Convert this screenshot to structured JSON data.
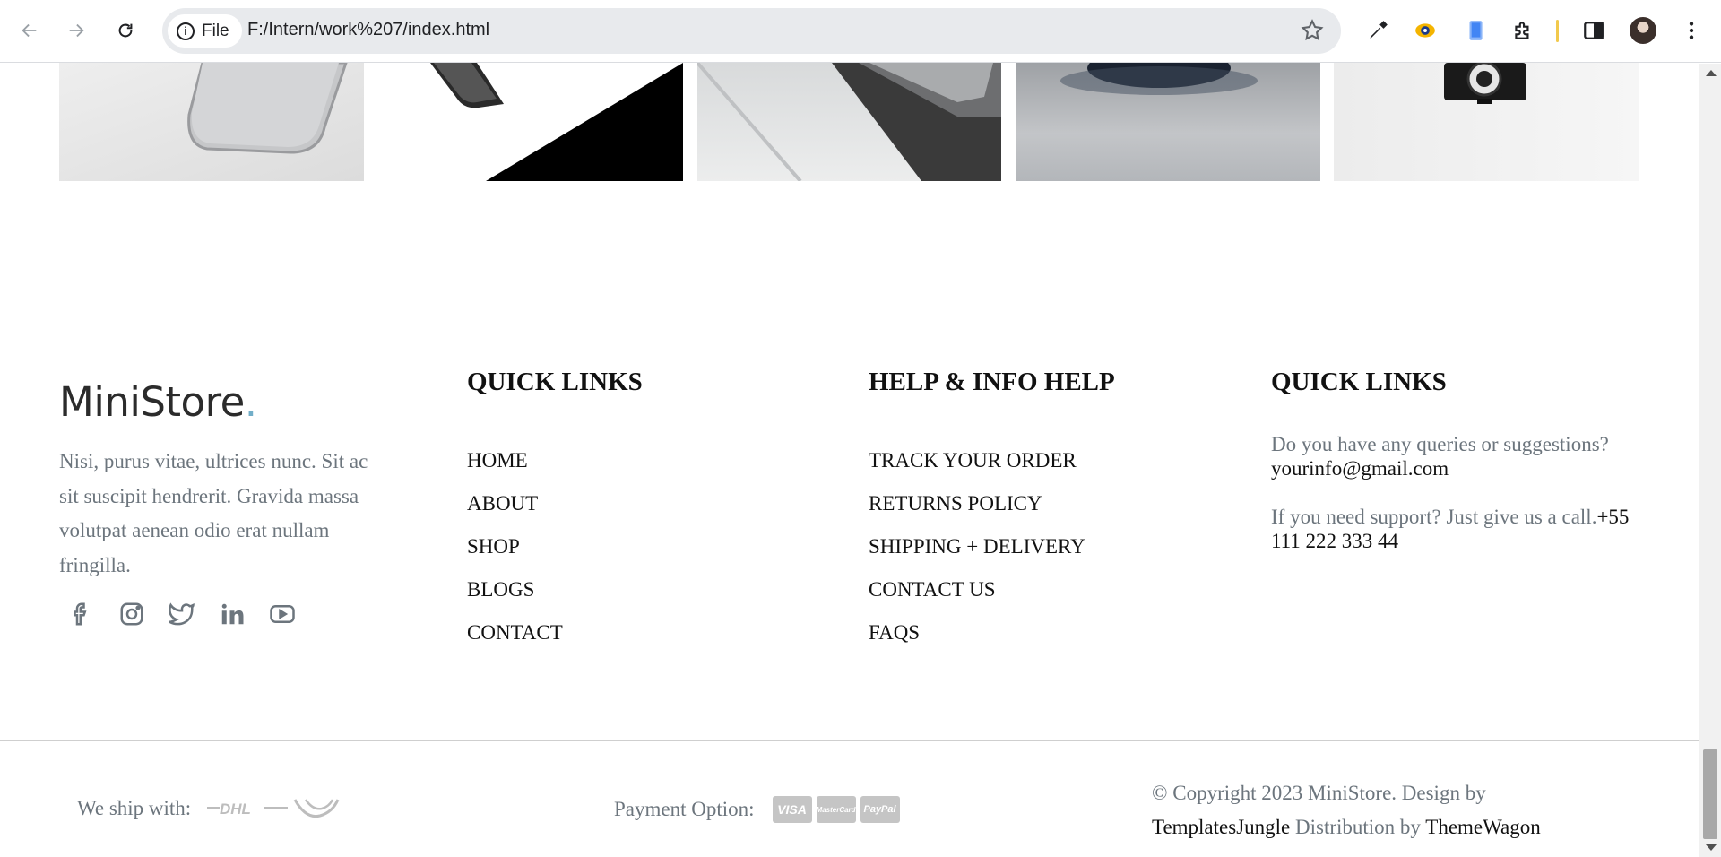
{
  "browser": {
    "chip_label": "File",
    "url": "F:/Intern/work%207/index.html"
  },
  "footer": {
    "brand_name": "MiniStore",
    "brand_dot": ".",
    "description": "Nisi, purus vitae, ultrices nunc. Sit ac sit suscipit hendrerit. Gravida massa volutpat aenean odio erat nullam fringilla.",
    "socials": [
      "facebook-icon",
      "instagram-icon",
      "twitter-icon",
      "linkedin-icon",
      "youtube-icon"
    ],
    "quick_links": {
      "title": "QUICK LINKS",
      "items": [
        "HOME",
        "ABOUT",
        "SHOP",
        "BLOGS",
        "CONTACT"
      ]
    },
    "help_info": {
      "title": "HELP & INFO HELP",
      "items": [
        "TRACK YOUR ORDER",
        "RETURNS POLICY",
        "SHIPPING + DELIVERY",
        "CONTACT US",
        "FAQS"
      ]
    },
    "contact": {
      "title": "QUICK LINKS",
      "query_text": "Do you have any queries or suggestions?",
      "email": "yourinfo@gmail.com",
      "support_text": "If you need support? Just give us a call.",
      "phone": "+55 111 222 333 44"
    }
  },
  "bottom_bar": {
    "ship_label": "We ship with:",
    "ship_carriers": [
      "DHL"
    ],
    "payment_label": "Payment Option:",
    "payment_cards": [
      "VISA",
      "MasterCard",
      "PayPal"
    ],
    "copyright_prefix": "© Copyright 2023 MiniStore. Design by",
    "designer": "TemplatesJungle",
    "distribution_label": "Distribution by",
    "distributor": "ThemeWagon"
  },
  "colors": {
    "muted_text": "#6c757d",
    "brand_dot": "#72aec8"
  }
}
